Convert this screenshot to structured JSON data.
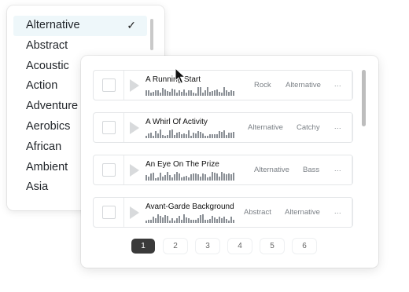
{
  "genres": {
    "items": [
      {
        "label": "Alternative",
        "selected": true
      },
      {
        "label": "Abstract",
        "selected": false
      },
      {
        "label": "Acoustic",
        "selected": false
      },
      {
        "label": "Action",
        "selected": false
      },
      {
        "label": "Adventure",
        "selected": false
      },
      {
        "label": "Aerobics",
        "selected": false
      },
      {
        "label": "African",
        "selected": false
      },
      {
        "label": "Ambient",
        "selected": false
      },
      {
        "label": "Asia",
        "selected": false
      }
    ],
    "check_glyph": "✓"
  },
  "tracks": [
    {
      "title": "A Running Start",
      "tags": [
        "Rock",
        "Alternative"
      ],
      "more": "..."
    },
    {
      "title": "A Whirl Of Activity",
      "tags": [
        "Alternative",
        "Catchy"
      ],
      "more": "..."
    },
    {
      "title": "An Eye On The Prize",
      "tags": [
        "Alternative",
        "Bass"
      ],
      "more": "..."
    },
    {
      "title": "Avant-Garde Background",
      "tags": [
        "Abstract",
        "Alternative"
      ],
      "more": "..."
    }
  ],
  "pagination": {
    "pages": [
      "1",
      "2",
      "3",
      "4",
      "5",
      "6"
    ],
    "current": "1"
  },
  "icons": {
    "checkmark": "checkmark-icon",
    "play": "play-icon",
    "cursor": "mouse-cursor-icon"
  },
  "colors": {
    "selected_row_bg": "#eef7fa",
    "active_page_bg": "#3a3a3a",
    "waveform": "#8a8f95",
    "muted_text": "#7b8086"
  }
}
